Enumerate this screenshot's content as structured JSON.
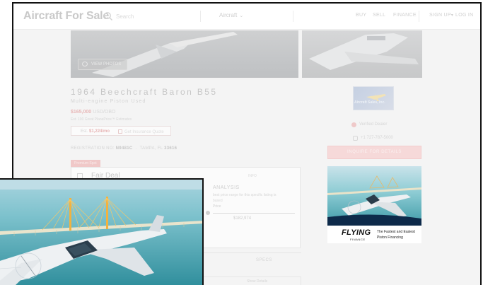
{
  "header": {
    "logo": "Aircraft For Sale",
    "search_placeholder": "Search",
    "aircraft_menu": "Aircraft",
    "nav": [
      "BUY",
      "SELL",
      "FINANCE"
    ],
    "signup": "SIGN UP",
    "login": "LOG IN"
  },
  "listing": {
    "view_photos": "VIEW PHOTOS",
    "title": "1964 Beechcraft Baron B55",
    "subtitle": "Multi-engine Piston Used",
    "price": "$165,000",
    "price_sub": "USD/OBO",
    "price_note": "Est. 100 Great PlanePrice™ Estimates",
    "est_payment_label": "Est.",
    "est_payment": "$1,224/mo",
    "est_insurance": "Get Insurance Quote",
    "reg_label": "REGISTRATION NO:",
    "reg_value": "N9481C",
    "location_label": "TAMPA, FL",
    "location_value": "33616",
    "badge": "Premium Spot",
    "deal_title": "Fair Deal",
    "deal_info": "INFO",
    "analysis_heading": "ANALYSIS",
    "analysis_text": "best price range for this specific listing is",
    "analysis_text2": "based",
    "analysis_text3": "Price",
    "range_value": "$182,974",
    "tab_specs": "SPECS",
    "tab_alt": "",
    "detail_text": "Show Details"
  },
  "sidebar": {
    "dealer_logo_text": "Aircraft Sales, Inc.",
    "dealer_name": "Verified Dealer",
    "dealer_phone": "+1 727-787-5000",
    "inquire_label": "INQUIRE FOR DETAILS"
  },
  "ad": {
    "brand": "FLYING",
    "finance": "FINANCE",
    "tagline1": "The Fastest and Easiest",
    "tagline2": "Piston Financing"
  }
}
